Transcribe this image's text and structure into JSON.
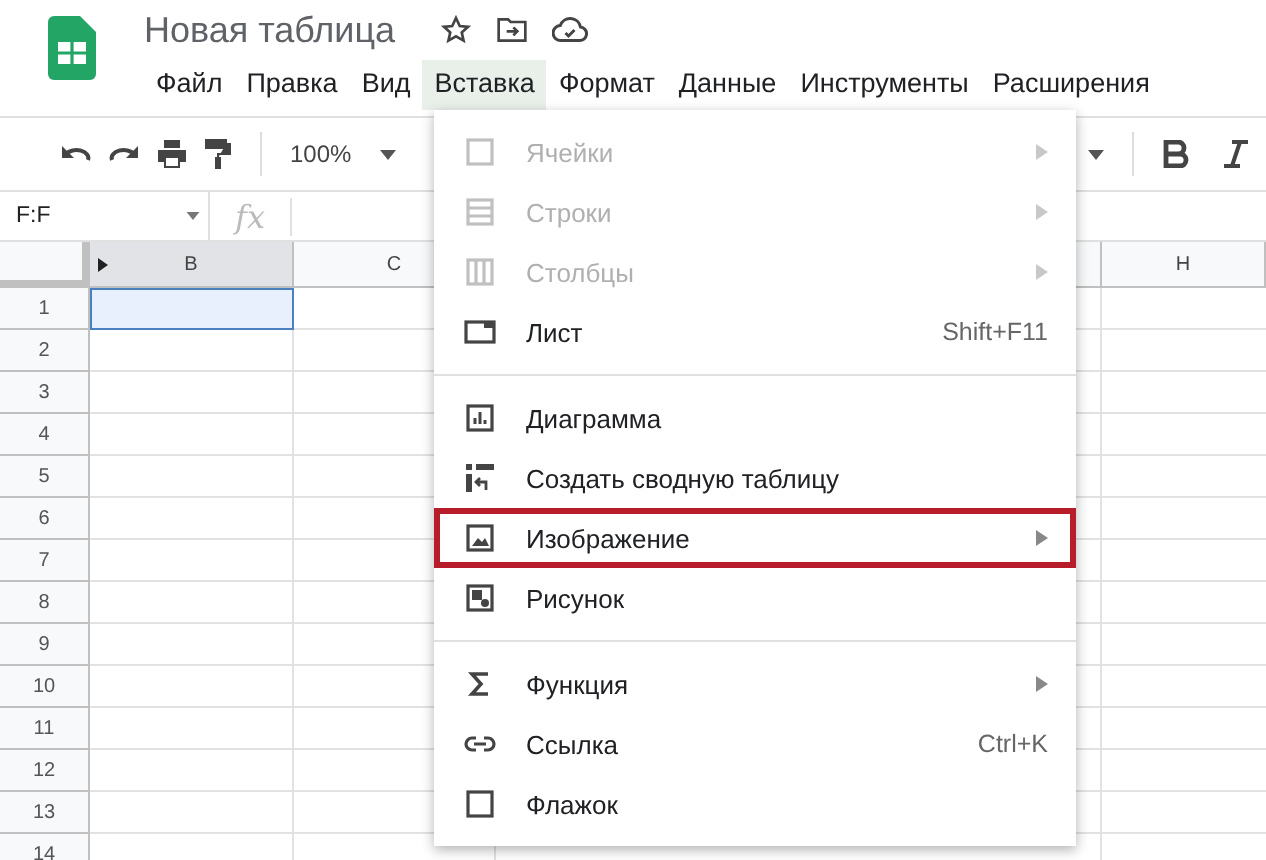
{
  "app": {
    "title": "Новая таблица",
    "menu": [
      {
        "label": "Файл",
        "selected": false
      },
      {
        "label": "Правка",
        "selected": false
      },
      {
        "label": "Вид",
        "selected": false
      },
      {
        "label": "Вставка",
        "selected": true
      },
      {
        "label": "Формат",
        "selected": false
      },
      {
        "label": "Данные",
        "selected": false
      },
      {
        "label": "Инструменты",
        "selected": false
      },
      {
        "label": "Расширения",
        "selected": false
      }
    ]
  },
  "toolbar": {
    "zoom": "100%"
  },
  "formula_bar": {
    "name_box": "F:F",
    "fx": "fx"
  },
  "sheet": {
    "columns": [
      {
        "label": "B",
        "selected": true
      },
      {
        "label": "C",
        "selected": false
      },
      {
        "label": "H",
        "selected": false
      }
    ],
    "rows": [
      "1",
      "2",
      "3",
      "4",
      "5",
      "6",
      "7",
      "8",
      "9",
      "10",
      "11",
      "12",
      "13",
      "14"
    ]
  },
  "insert_menu": {
    "groups": [
      [
        {
          "label": "Ячейки",
          "kind": "cells",
          "submenu": true,
          "disabled": true,
          "highlighted": false
        },
        {
          "label": "Строки",
          "kind": "rows",
          "submenu": true,
          "disabled": true,
          "highlighted": false
        },
        {
          "label": "Столбцы",
          "kind": "columns",
          "submenu": true,
          "disabled": true,
          "highlighted": false
        },
        {
          "label": "Лист",
          "kind": "sheet",
          "shortcut": "Shift+F11",
          "submenu": false,
          "disabled": false,
          "highlighted": false
        }
      ],
      [
        {
          "label": "Диаграмма",
          "kind": "chart",
          "submenu": false,
          "disabled": false,
          "highlighted": false
        },
        {
          "label": "Создать сводную таблицу",
          "kind": "pivot",
          "submenu": false,
          "disabled": false,
          "highlighted": false
        },
        {
          "label": "Изображение",
          "kind": "image",
          "submenu": true,
          "disabled": false,
          "highlighted": true
        },
        {
          "label": "Рисунок",
          "kind": "drawing",
          "submenu": false,
          "disabled": false,
          "highlighted": false
        }
      ],
      [
        {
          "label": "Функция",
          "kind": "function",
          "submenu": true,
          "disabled": false,
          "highlighted": false
        },
        {
          "label": "Ссылка",
          "kind": "link",
          "shortcut": "Ctrl+K",
          "submenu": false,
          "disabled": false,
          "highlighted": false
        },
        {
          "label": "Флажок",
          "kind": "checkbox",
          "submenu": false,
          "disabled": false,
          "highlighted": false
        }
      ]
    ]
  }
}
